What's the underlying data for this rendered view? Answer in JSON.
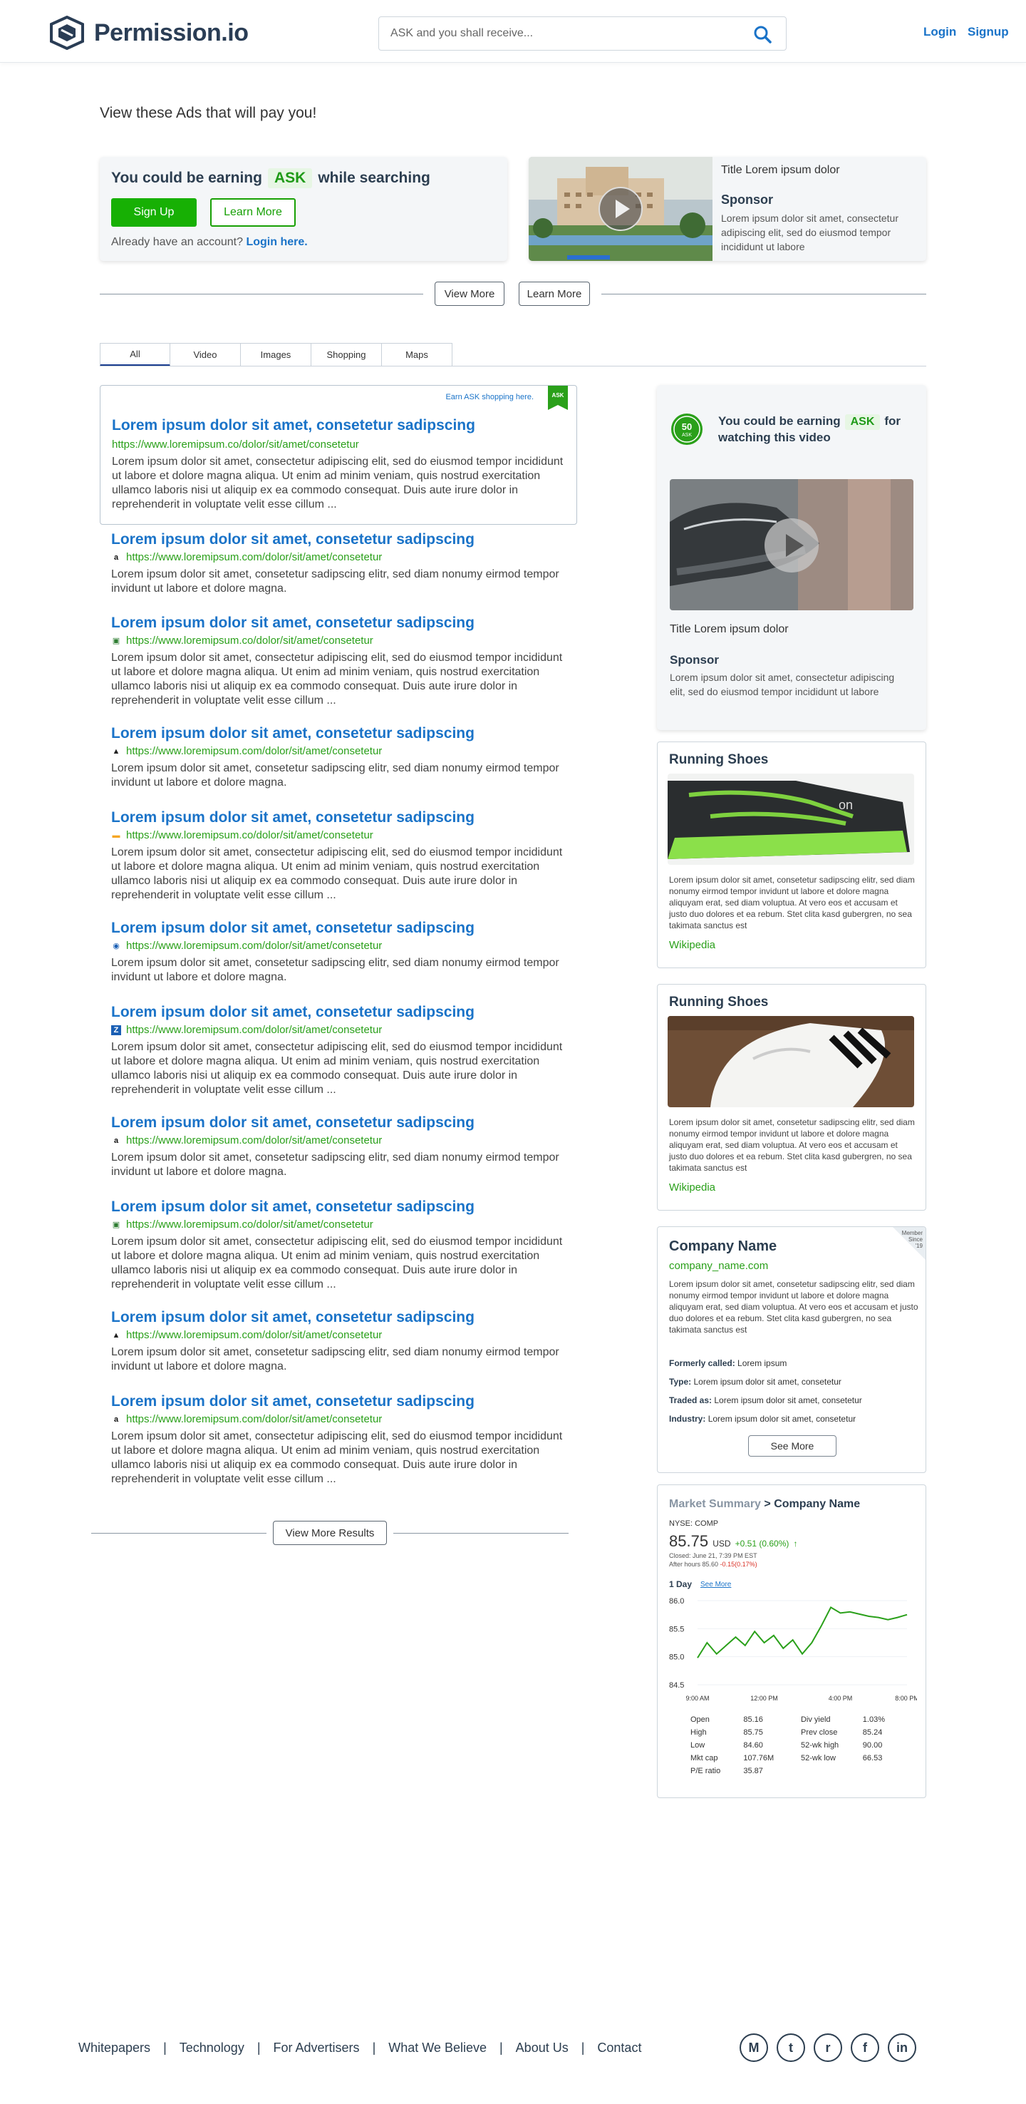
{
  "header": {
    "brand": "Permission.io",
    "search_placeholder": "ASK and you shall receive...",
    "login": "Login",
    "signup": "Signup"
  },
  "ads": {
    "heading": "View these Ads that will pay you!",
    "earn": {
      "prefix": "You could be earning",
      "ask": "ASK",
      "suffix": "while searching",
      "signup_btn": "Sign Up",
      "learn_btn": "Learn More",
      "already": "Already have an account?",
      "login_link": "Login here."
    },
    "video": {
      "title": "Title Lorem ipsum dolor",
      "sponsor": "Sponsor",
      "desc": "Lorem ipsum dolor sit amet, consectetur adipiscing elit, sed do eiusmod tempor incididunt ut labore"
    },
    "view_more": "View More",
    "learn_more": "Learn More"
  },
  "tabs": [
    "All",
    "Video",
    "Images",
    "Shopping",
    "Maps"
  ],
  "featured": {
    "note": "Earn ASK shopping here.",
    "ribbon": "ASK",
    "title": "Lorem ipsum dolor sit amet, consetetur sadipscing",
    "url": "https://www.loremipsum.co/dolor/sit/amet/consetetur",
    "text": "Lorem ipsum dolor sit amet, consectetur adipiscing elit, sed do eiusmod tempor incididunt ut labore et dolore magna aliqua. Ut enim ad minim veniam, quis nostrud exercitation ullamco laboris nisi ut aliquip ex ea commodo consequat. Duis aute irure dolor in reprehenderit in voluptate velit esse cillum ..."
  },
  "results": [
    {
      "title": "Lorem ipsum dolor sit amet, consetetur sadipscing",
      "url": "https://www.loremipsum.com/dolor/sit/amet/consetetur",
      "favicon": "amazon-icon",
      "text": "Lorem ipsum dolor sit amet, consetetur sadipscing elitr, sed diam nonumy eirmod tempor invidunt ut labore et dolore magna."
    },
    {
      "title": "Lorem ipsum dolor sit amet, consetetur sadipscing",
      "url": "https://www.loremipsum.co/dolor/sit/amet/consetetur",
      "favicon": "green-square-icon",
      "text": "Lorem ipsum dolor sit amet, consectetur adipiscing elit, sed do eiusmod tempor incididunt ut labore et dolore magna aliqua. Ut enim ad minim veniam, quis nostrud exercitation ullamco laboris nisi ut aliquip ex ea commodo consequat. Duis aute irure dolor in reprehenderit in voluptate velit esse cillum ..."
    },
    {
      "title": "Lorem ipsum dolor sit amet, consetetur sadipscing",
      "url": "https://www.loremipsum.com/dolor/sit/amet/consetetur",
      "favicon": "sail-icon",
      "text": "Lorem ipsum dolor sit amet, consetetur sadipscing elitr, sed diam nonumy eirmod tempor invidunt ut labore et dolore magna."
    },
    {
      "title": "Lorem ipsum dolor sit amet, consetetur sadipscing",
      "url": "https://www.loremipsum.co/dolor/sit/amet/consetetur",
      "favicon": "orange-card-icon",
      "text": "Lorem ipsum dolor sit amet, consectetur adipiscing elit, sed do eiusmod tempor incididunt ut labore et dolore magna aliqua. Ut enim ad minim veniam, quis nostrud exercitation ullamco laboris nisi ut aliquip ex ea commodo consequat. Duis aute irure dolor in reprehenderit in voluptate velit esse cillum ..."
    },
    {
      "title": "Lorem ipsum dolor sit amet, consetetur sadipscing",
      "url": "https://www.loremipsum.com/dolor/sit/amet/consetetur",
      "favicon": "globe-icon",
      "text": "Lorem ipsum dolor sit amet, consetetur sadipscing elitr, sed diam nonumy eirmod tempor invidunt ut labore et dolore magna."
    },
    {
      "title": "Lorem ipsum dolor sit amet, consetetur sadipscing",
      "url": "https://www.loremipsum.com/dolor/sit/amet/consetetur",
      "favicon": "blue-square-icon",
      "text": "Lorem ipsum dolor sit amet, consectetur adipiscing elit, sed do eiusmod tempor incididunt ut labore et dolore magna aliqua. Ut enim ad minim veniam, quis nostrud exercitation ullamco laboris nisi ut aliquip ex ea commodo consequat. Duis aute irure dolor in reprehenderit in voluptate velit esse cillum ..."
    },
    {
      "title": "Lorem ipsum dolor sit amet, consetetur sadipscing",
      "url": "https://www.loremipsum.com/dolor/sit/amet/consetetur",
      "favicon": "amazon-icon",
      "text": "Lorem ipsum dolor sit amet, consetetur sadipscing elitr, sed diam nonumy eirmod tempor invidunt ut labore et dolore magna."
    },
    {
      "title": "Lorem ipsum dolor sit amet, consetetur sadipscing",
      "url": "https://www.loremipsum.co/dolor/sit/amet/consetetur",
      "favicon": "green-square-icon",
      "text": "Lorem ipsum dolor sit amet, consectetur adipiscing elit, sed do eiusmod tempor incididunt ut labore et dolore magna aliqua. Ut enim ad minim veniam, quis nostrud exercitation ullamco laboris nisi ut aliquip ex ea commodo consequat. Duis aute irure dolor in reprehenderit in voluptate velit esse cillum ..."
    },
    {
      "title": "Lorem ipsum dolor sit amet, consetetur sadipscing",
      "url": "https://www.loremipsum.com/dolor/sit/amet/consetetur",
      "favicon": "sail-icon",
      "text": "Lorem ipsum dolor sit amet, consetetur sadipscing elitr, sed diam nonumy eirmod tempor invidunt ut labore et dolore magna."
    },
    {
      "title": "Lorem ipsum dolor sit amet, consetetur sadipscing",
      "url": "https://www.loremipsum.com/dolor/sit/amet/consetetur",
      "favicon": "amazon-icon",
      "text": "Lorem ipsum dolor sit amet, consectetur adipiscing elit, sed do eiusmod tempor incididunt ut labore et dolore magna aliqua. Ut enim ad minim veniam, quis nostrud exercitation ullamco laboris nisi ut aliquip ex ea commodo consequat. Duis aute irure dolor in reprehenderit in voluptate velit esse cillum ..."
    }
  ],
  "view_more_results": "View More Results",
  "sidebar": {
    "badge_num": "50",
    "badge_label": "ASK",
    "earn_prefix": "You could be earning",
    "earn_ask": "ASK",
    "earn_for": "for",
    "earn_suffix": "watching this video",
    "video_title": "Title Lorem ipsum dolor",
    "sponsor": "Sponsor",
    "video_desc": "Lorem ipsum dolor sit amet, consectetur adipiscing elit, sed do eiusmod tempor incididunt ut labore",
    "cards": [
      {
        "title": "Running Shoes",
        "text": "Lorem ipsum dolor sit amet, consetetur sadipscing elitr, sed diam nonumy eirmod tempor invidunt ut labore et dolore magna aliquyam erat, sed diam voluptua. At vero eos et accusam et justo duo dolores et ea rebum. Stet clita kasd gubergren, no sea takimata sanctus est",
        "link": "Wikipedia"
      },
      {
        "title": "Running Shoes",
        "text": "Lorem ipsum dolor sit amet, consetetur sadipscing elitr, sed diam nonumy eirmod tempor invidunt ut labore et dolore magna aliquyam erat, sed diam voluptua. At vero eos et accusam et justo duo dolores et ea rebum. Stet clita kasd gubergren, no sea takimata sanctus est",
        "link": "Wikipedia"
      }
    ],
    "company": {
      "badge_l1": "Member",
      "badge_l2": "Since",
      "badge_l3": "'19",
      "name": "Company Name",
      "url": "company_name.com",
      "text": "Lorem ipsum dolor sit amet, consetetur sadipscing elitr, sed diam nonumy eirmod tempor invidunt ut labore et dolore magna aliquyam erat, sed diam voluptua. At vero eos et accusam et justo duo dolores et ea rebum. Stet clita kasd gubergren, no sea takimata sanctus est",
      "facts": [
        {
          "label": "Formerly called:",
          "value": "Lorem ipsum"
        },
        {
          "label": "Type:",
          "value": "Lorem ipsum dolor sit amet, consetetur"
        },
        {
          "label": "Traded as:",
          "value": "Lorem ipsum dolor sit amet, consetetur"
        },
        {
          "label": "Industry:",
          "value": "Lorem ipsum dolor sit amet, consetetur"
        }
      ],
      "see_more": "See More"
    },
    "market": {
      "summary": "Market Summary",
      "arrow": ">",
      "company": "Company Name",
      "ticker": "NYSE: COMP",
      "price": "85.75",
      "currency": "USD",
      "change": "+0.51 (0.60%)",
      "change_arrow": "↑",
      "closed": "Closed: June 21, 7:39 PM EST",
      "after_prefix": "After hours 85.60",
      "after_change": "-0.15(0.17%)",
      "range": "1 Day",
      "see_more": "See More",
      "stats": [
        [
          "Open",
          "85.16",
          "Div yield",
          "1.03%"
        ],
        [
          "High",
          "85.75",
          "Prev close",
          "85.24"
        ],
        [
          "Low",
          "84.60",
          "52-wk high",
          "90.00"
        ],
        [
          "Mkt cap",
          "107.76M",
          "52-wk low",
          "66.53"
        ],
        [
          "P/E ratio",
          "35.87",
          "",
          ""
        ]
      ]
    }
  },
  "chart_data": {
    "type": "line",
    "title": "",
    "xlabel": "",
    "ylabel": "",
    "x_ticks": [
      "9:00 AM",
      "12:00 PM",
      "4:00 PM",
      "8:00 PM"
    ],
    "y_ticks": [
      "86.0",
      "85.5",
      "85.0",
      "84.5"
    ],
    "ylim": [
      84.5,
      86.0
    ],
    "color": "#2aa01a",
    "x": [
      0,
      0.5,
      1,
      1.5,
      2,
      2.5,
      3,
      3.5,
      4,
      4.5,
      5,
      5.5,
      6,
      6.5,
      7,
      7.5,
      8,
      8.5,
      9,
      9.5,
      10,
      10.5,
      11
    ],
    "values": [
      84.98,
      85.25,
      85.05,
      85.2,
      85.35,
      85.2,
      85.45,
      85.25,
      85.38,
      85.15,
      85.3,
      85.05,
      85.25,
      85.55,
      85.88,
      85.78,
      85.8,
      85.76,
      85.72,
      85.7,
      85.66,
      85.7,
      85.75
    ]
  },
  "footer": {
    "links": [
      "Whitepapers",
      "Technology",
      "For Advertisers",
      "What We Believe",
      "About Us",
      "Contact"
    ],
    "separator": "|",
    "socials": [
      {
        "name": "medium-icon",
        "glyph": "M"
      },
      {
        "name": "twitter-icon",
        "glyph": "t"
      },
      {
        "name": "reddit-icon",
        "glyph": "r"
      },
      {
        "name": "facebook-icon",
        "glyph": "f"
      },
      {
        "name": "linkedin-icon",
        "glyph": "in"
      }
    ]
  }
}
